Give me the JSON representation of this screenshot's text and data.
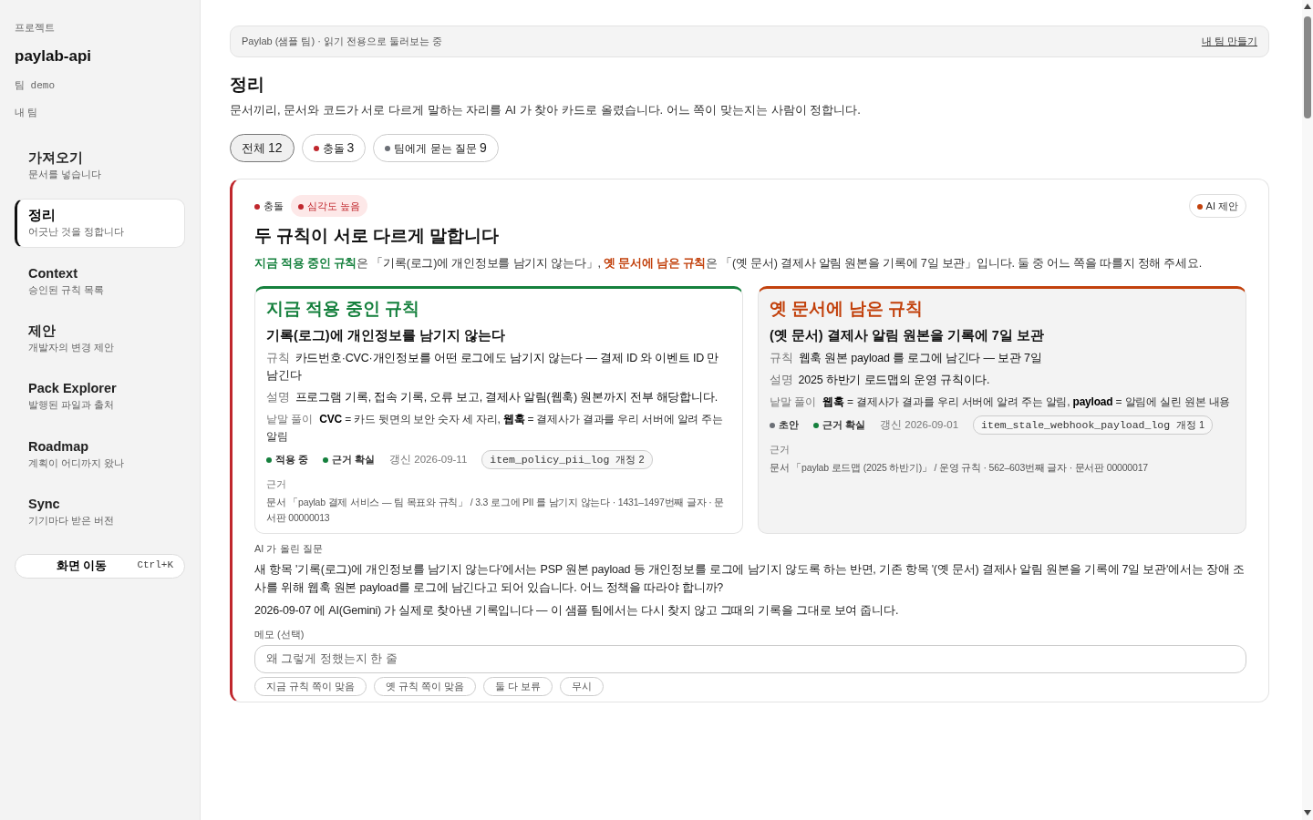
{
  "sidebar": {
    "label": "프로젝트",
    "project": "paylab-api",
    "team": "팀 demo",
    "my_team": "내 팀",
    "items": [
      {
        "title": "가져오기",
        "subtitle": "문서를 넣습니다",
        "selected": false
      },
      {
        "title": "정리",
        "subtitle": "어긋난 것을 정합니다",
        "selected": true
      },
      {
        "title": "Context",
        "subtitle": "승인된 규칙 목록",
        "selected": false
      },
      {
        "title": "제안",
        "subtitle": "개발자의 변경 제안",
        "selected": false
      },
      {
        "title": "Pack Explorer",
        "subtitle": "발행된 파일과 출처",
        "selected": false
      },
      {
        "title": "Roadmap",
        "subtitle": "계획이 어디까지 왔나",
        "selected": false
      },
      {
        "title": "Sync",
        "subtitle": "기기마다 받은 버전",
        "selected": false
      }
    ],
    "goto": {
      "label": "화면 이동",
      "shortcut": "Ctrl+K"
    }
  },
  "banner": {
    "text": "Paylab (샘플 팀) · 읽기 전용으로 둘러보는 중",
    "link": "내 팀 만들기"
  },
  "page": {
    "title": "정리",
    "description": "문서끼리, 문서와 코드가 서로 다르게 말하는 자리를 AI 가 찾아 카드로 올렸습니다. 어느 쪽이 맞는지는 사람이 정합니다."
  },
  "filters": [
    {
      "label": "전체",
      "count": "12",
      "selected": true
    },
    {
      "label": "충돌",
      "count": "3",
      "color": "#c0272d",
      "selected": false
    },
    {
      "label": "팀에게 묻는 질문",
      "count": "9",
      "color": "#6b6f76",
      "selected": false
    }
  ],
  "card": {
    "tags": [
      {
        "kind": "plain",
        "label": "충돌",
        "color": "#c0272d"
      },
      {
        "kind": "pill",
        "label": "심각도 높음",
        "color": "#c0272d"
      }
    ],
    "badge": {
      "label": "AI 제안",
      "color": "#c2410c"
    },
    "title": "두 규칙이 서로 다르게 말합니다",
    "summary": [
      {
        "kind": "current",
        "text": "지금 적용 중인 규칙"
      },
      {
        "kind": "plain",
        "text": "은 「기록(로그)에 개인정보를 남기지 않는다」, "
      },
      {
        "kind": "old",
        "text": "옛 문서에 남은 규칙"
      },
      {
        "kind": "plain",
        "text": "은 「(옛 문서) 결제사 알림 원본을 기록에 7일 보관」입니다. 둘 중 어느 쪽을 따를지 정해 주세요."
      }
    ],
    "rules": [
      {
        "kind": "current",
        "color": "#15803d",
        "heading": "지금 적용 중인 규칙",
        "title": "기록(로그)에 개인정보를 남기지 않는다",
        "rows": [
          {
            "label": "규칙",
            "text": "카드번호·CVC·개인정보를 어떤 로그에도 남기지 않는다 — 결제 ID 와 이벤트 ID 만 남긴다"
          },
          {
            "label": "설명",
            "text": "프로그램 기록, 접속 기록, 오류 보고, 결제사 알림(웹훅) 원본까지 전부 해당합니다."
          }
        ],
        "glossary": {
          "label": "낱말 풀이",
          "text": "**CVC** = 카드 뒷면의 보안 숫자 세 자리, **웹훅** = 결제사가 결과를 우리 서버에 알려 주는 알림"
        },
        "status": [
          {
            "label": "적용 중",
            "color": "#15803d"
          },
          {
            "label": "근거 확실",
            "color": "#15803d"
          }
        ],
        "updated": "갱신 2026-09-11",
        "code": {
          "id": "item_policy_pii_log",
          "rev": "개정 2"
        },
        "evidence_label": "근거",
        "evidence": "문서 「paylab 결제 서비스 — 팀 목표와 규칙」 / 3.3 로그에 PII 를 남기지 않는다 · 1431–1497번째 글자 · 문서판 00000013"
      },
      {
        "kind": "old",
        "color": "#c2410c",
        "heading": "옛 문서에 남은 규칙",
        "title": "(옛 문서) 결제사 알림 원본을 기록에 7일 보관",
        "rows": [
          {
            "label": "규칙",
            "text": "웹훅 원본 payload 를 로그에 남긴다 — 보관 7일"
          },
          {
            "label": "설명",
            "text": "2025 하반기 로드맵의 운영 규칙이다."
          }
        ],
        "glossary": {
          "label": "낱말 풀이",
          "text": "**웹훅** = 결제사가 결과를 우리 서버에 알려 주는 알림, **payload** = 알림에 실린 원본 내용"
        },
        "status": [
          {
            "label": "초안",
            "color": "#6b6f76"
          },
          {
            "label": "근거 확실",
            "color": "#15803d"
          }
        ],
        "updated": "갱신 2026-09-01",
        "code": {
          "id": "item_stale_webhook_payload_log",
          "rev": "개정 1"
        },
        "evidence_label": "근거",
        "evidence": "문서 「paylab 로드맵 (2025 하반기)」 / 운영 규칙 · 562–603번째 글자 · 문서판 00000017"
      }
    ],
    "question_label": "AI 가 올린 질문",
    "question": "새 항목 '기록(로그)에 개인정보를 남기지 않는다'에서는 PSP 원본 payload 등 개인정보를 로그에 남기지 않도록 하는 반면, 기존 항목 '(옛 문서) 결제사 알림 원본을 기록에 7일 보관'에서는 장애 조사를 위해 웹훅 원본 payload를 로그에 남긴다고 되어 있습니다. 어느 정책을 따라야 합니까?",
    "note": "2026-09-07 에 AI(Gemini) 가 실제로 찾아낸 기록입니다 — 이 샘플 팀에서는 다시 찾지 않고 그때의 기록을 그대로 보여 줍니다.",
    "memo_label": "메모 (선택)",
    "memo_placeholder": "왜 그렇게 정했는지 한 줄",
    "actions": [
      "지금 규칙 쪽이 맞음",
      "옛 규칙 쪽이 맞음",
      "둘 다 보류",
      "무시"
    ]
  }
}
